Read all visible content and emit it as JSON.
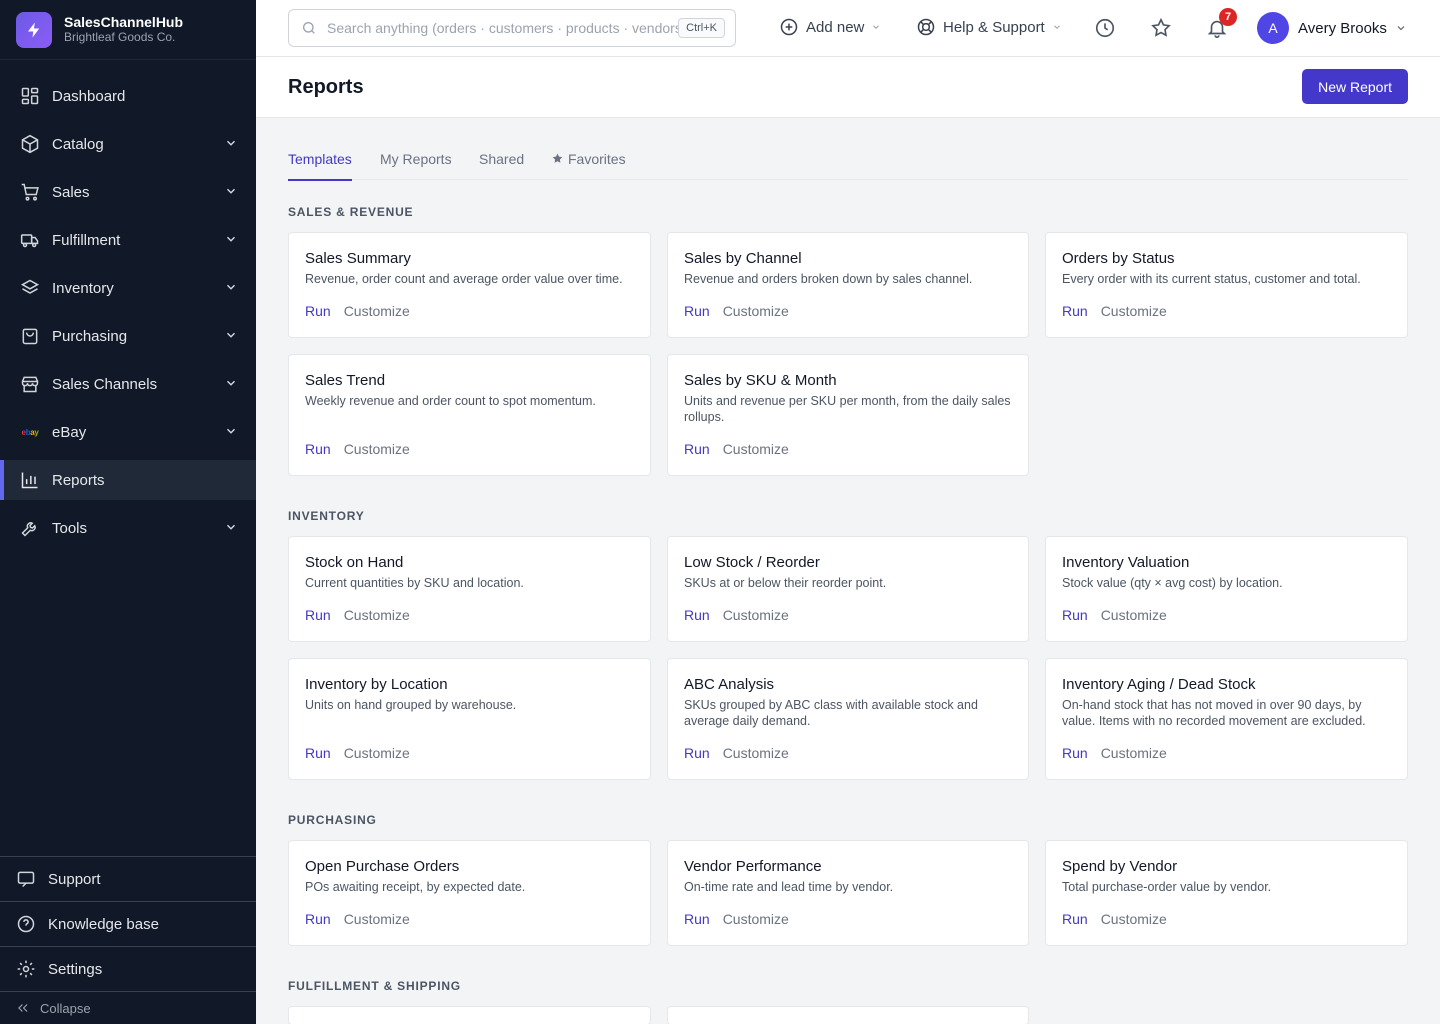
{
  "brand": {
    "name": "SalesChannelHub",
    "org": "Brightleaf Goods Co.",
    "accent": "#6d5ae6"
  },
  "sidebar": {
    "items": [
      {
        "label": "Dashboard",
        "icon": "dashboard-icon",
        "expandable": false
      },
      {
        "label": "Catalog",
        "icon": "box-icon",
        "expandable": true
      },
      {
        "label": "Sales",
        "icon": "cart-icon",
        "expandable": true
      },
      {
        "label": "Fulfillment",
        "icon": "truck-icon",
        "expandable": true
      },
      {
        "label": "Inventory",
        "icon": "layers-icon",
        "expandable": true
      },
      {
        "label": "Purchasing",
        "icon": "bag-icon",
        "expandable": true
      },
      {
        "label": "Sales Channels",
        "icon": "store-icon",
        "expandable": true
      },
      {
        "label": "eBay",
        "icon": "ebay-logo",
        "expandable": true
      },
      {
        "label": "Reports",
        "icon": "bar-chart-icon",
        "expandable": false,
        "active": true
      },
      {
        "label": "Tools",
        "icon": "wrench-icon",
        "expandable": true
      }
    ],
    "ebay_mark": "ebay",
    "bottom": {
      "support": "Support",
      "knowledge": "Knowledge base",
      "settings": "Settings",
      "collapse": "Collapse"
    }
  },
  "topbar": {
    "search_placeholder": "Search anything (orders · customers · products · vendors)",
    "shortcut": "Ctrl+K",
    "add_new": "Add new",
    "help": "Help & Support",
    "notifications_count": "7",
    "user": {
      "initial": "A",
      "name": "Avery Brooks"
    }
  },
  "page": {
    "title": "Reports",
    "new_button": "New Report"
  },
  "tabs": [
    "Templates",
    "My Reports",
    "Shared",
    "Favorites"
  ],
  "actions": {
    "run": "Run",
    "customize": "Customize"
  },
  "sections": [
    {
      "title": "SALES & REVENUE",
      "cards": [
        {
          "title": "Sales Summary",
          "desc": "Revenue, order count and average order value over time."
        },
        {
          "title": "Sales by Channel",
          "desc": "Revenue and orders broken down by sales channel."
        },
        {
          "title": "Orders by Status",
          "desc": "Every order with its current status, customer and total."
        },
        {
          "title": "Sales Trend",
          "desc": "Weekly revenue and order count to spot momentum."
        },
        {
          "title": "Sales by SKU & Month",
          "desc": "Units and revenue per SKU per month, from the daily sales rollups."
        }
      ]
    },
    {
      "title": "INVENTORY",
      "cards": [
        {
          "title": "Stock on Hand",
          "desc": "Current quantities by SKU and location."
        },
        {
          "title": "Low Stock / Reorder",
          "desc": "SKUs at or below their reorder point."
        },
        {
          "title": "Inventory Valuation",
          "desc": "Stock value (qty × avg cost) by location."
        },
        {
          "title": "Inventory by Location",
          "desc": "Units on hand grouped by warehouse."
        },
        {
          "title": "ABC Analysis",
          "desc": "SKUs grouped by ABC class with available stock and average daily demand."
        },
        {
          "title": "Inventory Aging / Dead Stock",
          "desc": "On-hand stock that has not moved in over 90 days, by value. Items with no recorded movement are excluded."
        }
      ]
    },
    {
      "title": "PURCHASING",
      "cards": [
        {
          "title": "Open Purchase Orders",
          "desc": "POs awaiting receipt, by expected date."
        },
        {
          "title": "Vendor Performance",
          "desc": "On-time rate and lead time by vendor."
        },
        {
          "title": "Spend by Vendor",
          "desc": "Total purchase-order value by vendor."
        }
      ]
    },
    {
      "title": "FULFILLMENT & SHIPPING",
      "cards": []
    }
  ]
}
